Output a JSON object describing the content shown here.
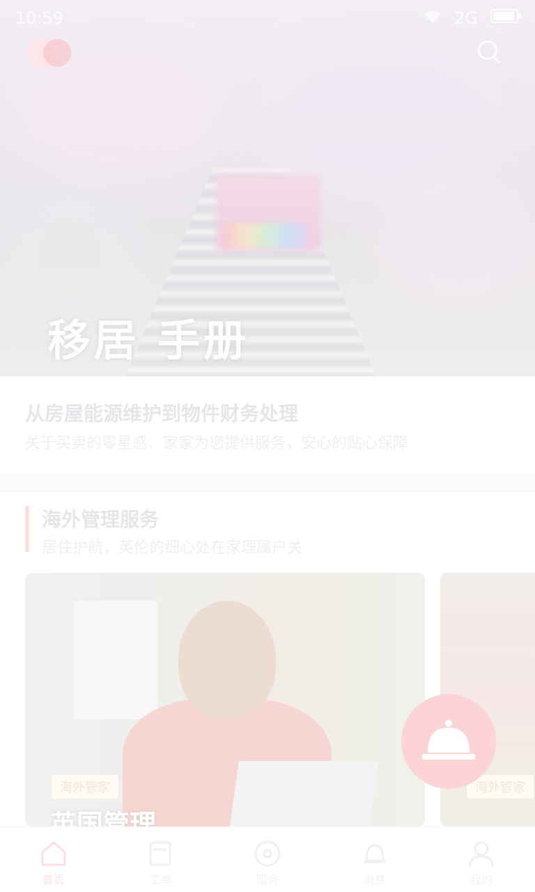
{
  "status_bar": {
    "time": "10:59",
    "network": "2G"
  },
  "hero": {
    "title": "移居 手册"
  },
  "intro": {
    "heading": "从房屋能源维护到物件财务处理",
    "text": "关于买卖的零星感、家家为您提供服务，安心的贴心保障"
  },
  "section": {
    "title": "海外管理服务",
    "subtitle": "居住护航，英伦的细心处在家理属户关"
  },
  "cards": [
    {
      "tag": "海外管家",
      "title": "英国管理"
    },
    {
      "tag": "海外管家",
      "title": ""
    }
  ],
  "tabs": [
    {
      "label": "首页",
      "icon": "home-icon",
      "active": true
    },
    {
      "label": "工单",
      "icon": "document-icon",
      "active": false
    },
    {
      "label": "服务",
      "icon": "compass-icon",
      "active": false
    },
    {
      "label": "消息",
      "icon": "bell-icon",
      "active": false
    },
    {
      "label": "我的",
      "icon": "user-icon",
      "active": false
    }
  ],
  "colors": {
    "accent": "#e53935",
    "overlay": "#ffffff"
  }
}
